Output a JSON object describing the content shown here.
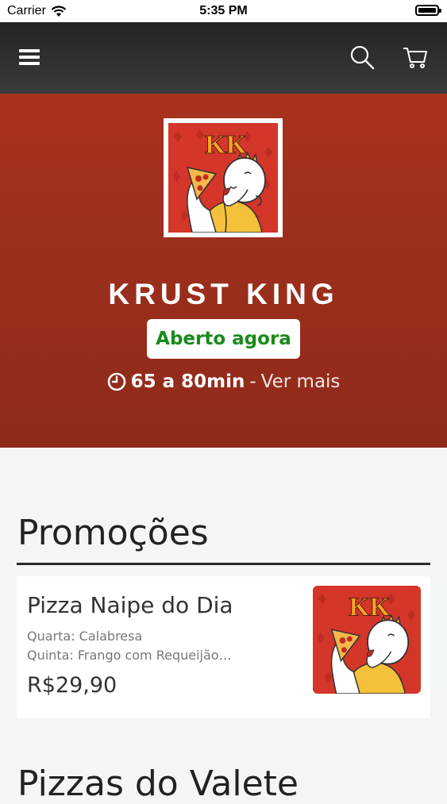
{
  "status_bar": {
    "carrier": "Carrier",
    "time": "5:35 PM"
  },
  "nav": {
    "menu_icon": "hamburger-icon",
    "search_icon": "search-icon",
    "cart_icon": "cart-icon"
  },
  "hero": {
    "restaurant_name": "KRUST KING",
    "logo_letters": "KK",
    "status": "Aberto agora",
    "delivery_time": "65 a 80min",
    "separator": "-",
    "more_link": "Ver mais"
  },
  "sections": [
    {
      "title": "Promoções",
      "items": [
        {
          "name": "Pizza Naipe do Dia",
          "description_lines": [
            "Quarta: Calabresa",
            "Quinta: Frango com Requeijão…"
          ],
          "price": "R$29,90"
        }
      ]
    },
    {
      "title": "Pizzas do Valete"
    }
  ],
  "colors": {
    "hero": "#a8321f",
    "open_text": "#1a8a1a",
    "nav": "#2e2f30"
  }
}
